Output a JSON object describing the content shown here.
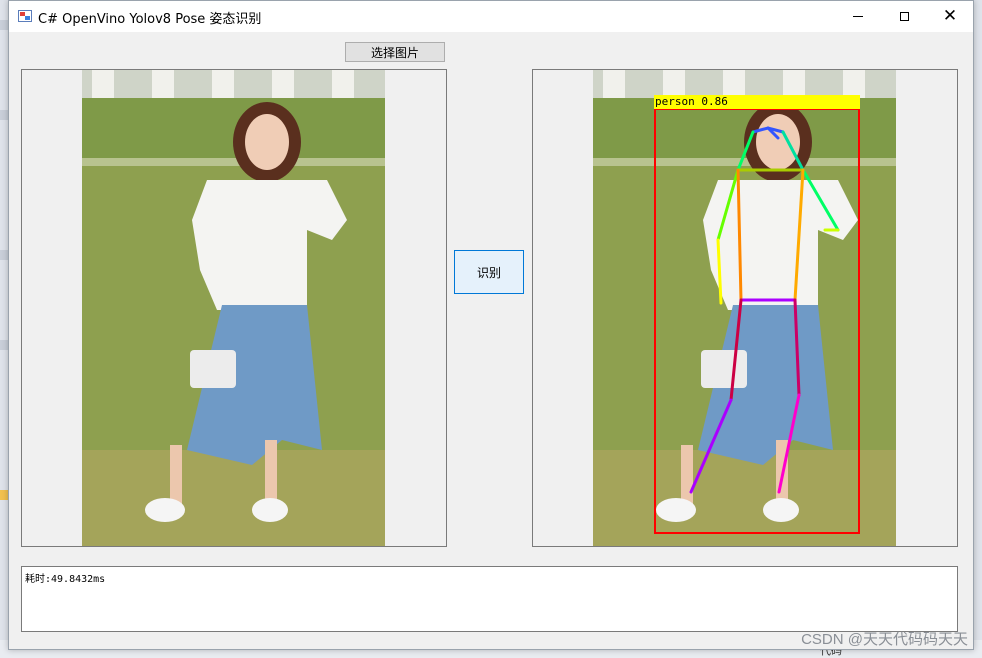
{
  "window": {
    "title": "C# OpenVino Yolov8 Pose 姿态识别",
    "controls": {
      "minimize": "minimize-icon",
      "maximize": "maximize-icon",
      "close": "close-icon"
    }
  },
  "buttons": {
    "select_image": "选择图片",
    "detect": "识别"
  },
  "images": {
    "left": {
      "icon": "photo-original",
      "description_colors": {
        "grass": "#8fa24e",
        "skirt": "#6f9ac6"
      }
    },
    "right": {
      "detection": {
        "label": "person  0.86",
        "box_color": "#ff0000",
        "label_bg": "#ffff00"
      }
    }
  },
  "log": {
    "text": "耗时:49.8432ms"
  },
  "watermark": "CSDN @天天代码码天天",
  "background_tag": "代码"
}
